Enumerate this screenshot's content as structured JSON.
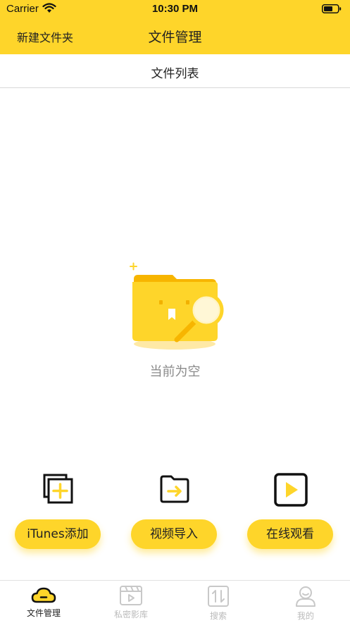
{
  "status_bar": {
    "carrier": "Carrier",
    "time": "10:30 PM"
  },
  "nav": {
    "left_button": "新建文件夹",
    "title": "文件管理"
  },
  "subheader": {
    "label": "文件列表"
  },
  "empty_state": {
    "text": "当前为空"
  },
  "actions": [
    {
      "label": "iTunes添加",
      "icon": "copy-add-icon"
    },
    {
      "label": "视频导入",
      "icon": "folder-import-icon"
    },
    {
      "label": "在线观看",
      "icon": "play-box-icon"
    }
  ],
  "tabs": [
    {
      "label": "文件管理",
      "icon": "cloud-icon",
      "active": true
    },
    {
      "label": "私密影库",
      "icon": "video-library-icon"
    },
    {
      "label": "搜索",
      "icon": "sort-arrows-icon"
    },
    {
      "label": "我的",
      "icon": "user-icon"
    }
  ],
  "colors": {
    "accent": "#FED52A",
    "inactive": "#BBBBBB",
    "text": "#222222"
  }
}
